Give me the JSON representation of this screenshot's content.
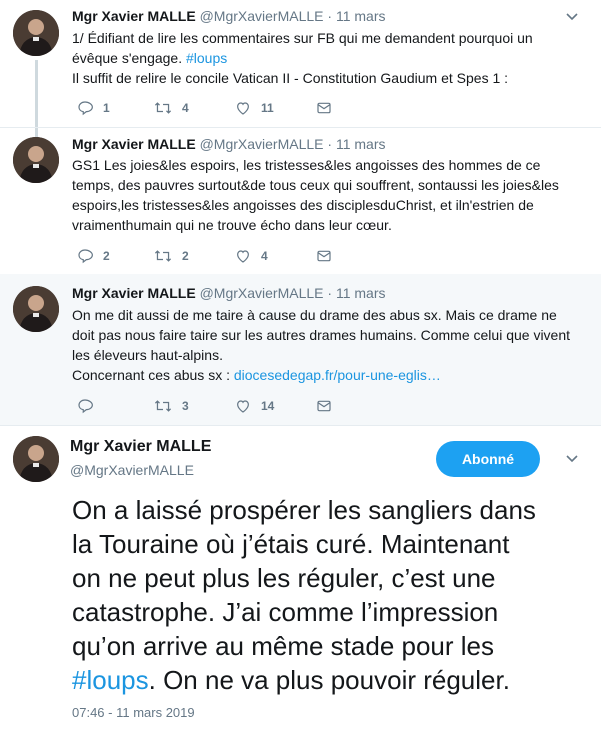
{
  "tweets": [
    {
      "name": "Mgr Xavier MALLE",
      "handle": "@MgrXavierMALLE",
      "separator": "·",
      "date": "11 mars",
      "lines": [
        {
          "before": "1/ Édifiant de lire les commentaires sur FB qui me demandent pourquoi un",
          "tag": "",
          "after": ""
        },
        {
          "before": "évêque s'engage. ",
          "tag": "#loups",
          "after": ""
        },
        {
          "before": "Il suffit de relire le concile Vatican II - Constitution Gaudium et Spes 1 :",
          "tag": "",
          "after": ""
        }
      ],
      "replies": "1",
      "retweets": "4",
      "likes": "11"
    },
    {
      "name": "Mgr Xavier MALLE",
      "handle": "@MgrXavierMALLE",
      "separator": "·",
      "date": "11 mars",
      "lines": [
        {
          "before": "GS1 Les joies&les espoirs, les tristesses&les angoisses des hommes de ce",
          "tag": "",
          "after": ""
        },
        {
          "before": "temps, des pauvres surtout&de tous ceux qui souffrent, sontaussi les joies&les",
          "tag": "",
          "after": ""
        },
        {
          "before": "espoirs,les tristesses&les angoisses des disciplesduChrist, et iln'estrien de",
          "tag": "",
          "after": ""
        },
        {
          "before": "vraimenthumain qui ne trouve écho dans leur cœur.",
          "tag": "",
          "after": ""
        }
      ],
      "replies": "2",
      "retweets": "2",
      "likes": "4"
    },
    {
      "name": "Mgr Xavier MALLE",
      "handle": "@MgrXavierMALLE",
      "separator": "·",
      "date": "11 mars",
      "lines": [
        {
          "before": "On me dit aussi de me taire à cause du drame des abus sx. Mais ce drame ne",
          "tag": "",
          "after": ""
        },
        {
          "before": "doit pas nous faire taire sur les autres drames humains. Comme celui que vivent",
          "tag": "",
          "after": ""
        },
        {
          "before": "les éleveurs haut-alpins.",
          "tag": "",
          "after": ""
        },
        {
          "before": "Concernant ces abus sx : ",
          "tag": "diocesedegap.fr/pour-une-eglis…",
          "after": ""
        }
      ],
      "replies": "",
      "retweets": "3",
      "likes": "14"
    }
  ],
  "main": {
    "name": "Mgr Xavier MALLE",
    "handle": "@MgrXavierMALLE",
    "follow_label": "Abonné",
    "lines": [
      {
        "before": "On a laissé prospérer les sangliers dans",
        "tag": "",
        "after": ""
      },
      {
        "before": "la Touraine où j’étais curé. Maintenant",
        "tag": "",
        "after": ""
      },
      {
        "before": "on ne peut plus les réguler, c’est une",
        "tag": "",
        "after": ""
      },
      {
        "before": "catastrophe. J’ai comme l’impression",
        "tag": "",
        "after": ""
      },
      {
        "before": "qu’on arrive au même stade pour les",
        "tag": "",
        "after": ""
      },
      {
        "before": "",
        "tag": "#loups",
        "after": ". On ne va plus pouvoir réguler."
      }
    ],
    "timestamp": "07:46 - 11 mars 2019"
  },
  "colors": {
    "accent": "#1b95e0",
    "follow_button": "#1da1f2",
    "muted": "#657786",
    "thread_shade": "#f5f8fa"
  },
  "icons": {
    "reply": "reply-icon",
    "retweet": "retweet-icon",
    "like": "heart-icon",
    "message": "envelope-icon",
    "more": "chevron-down-icon"
  }
}
